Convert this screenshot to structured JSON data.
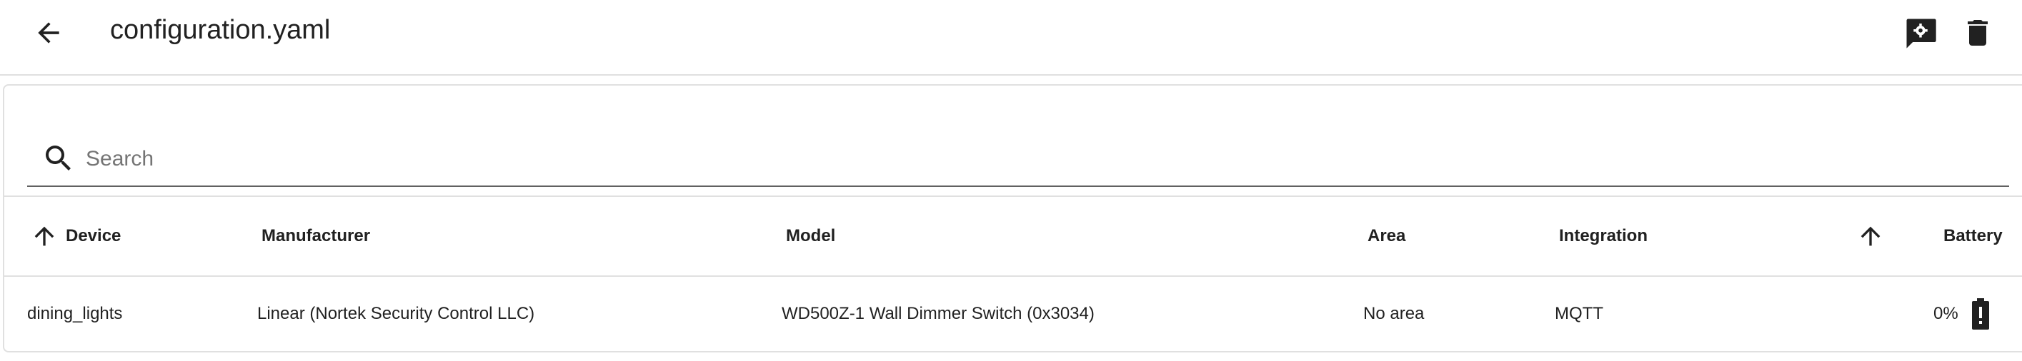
{
  "header": {
    "title": "configuration.yaml",
    "back_icon": "arrow-left-icon",
    "actions": [
      {
        "icon": "comment-settings-icon"
      },
      {
        "icon": "trash-icon"
      }
    ]
  },
  "search": {
    "placeholder": "Search",
    "value": ""
  },
  "table": {
    "columns": [
      {
        "label": "Device",
        "sorted": "asc"
      },
      {
        "label": "Manufacturer"
      },
      {
        "label": "Model"
      },
      {
        "label": "Area"
      },
      {
        "label": "Integration"
      },
      {
        "label": "",
        "sorted": "asc"
      },
      {
        "label": "Battery"
      }
    ],
    "rows": [
      {
        "device": "dining_lights",
        "manufacturer": "Linear (Nortek Security Control LLC)",
        "model": "WD500Z-1 Wall Dimmer Switch (0x3034)",
        "area": "No area",
        "integration": "MQTT",
        "battery": "0%",
        "battery_icon": "battery-alert-icon"
      }
    ]
  },
  "colors": {
    "text": "#212121",
    "divider": "#e0e0e0",
    "icon": "#212121"
  }
}
